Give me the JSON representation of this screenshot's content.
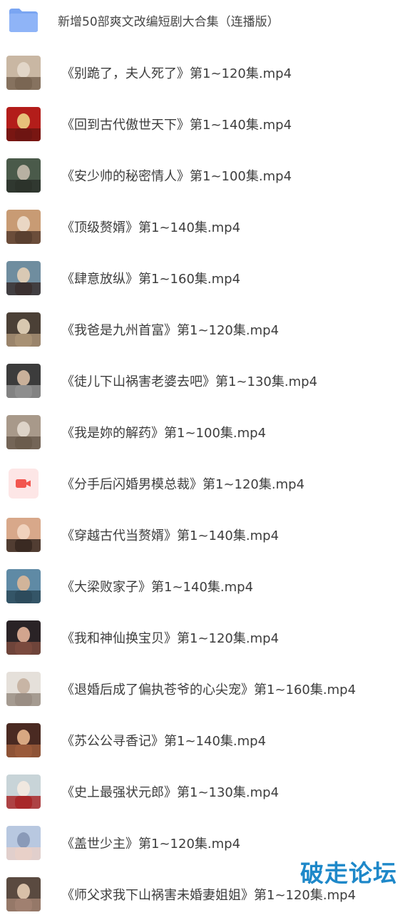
{
  "colors": {
    "folder": "#8fb4f7",
    "folder_tab": "#7aa5f2",
    "video_icon": "#f2564f",
    "watermark": "#1e88c9"
  },
  "folder": {
    "name": "新增50部爽文改编短剧大合集（连播版）",
    "icon": "folder-icon"
  },
  "files": [
    {
      "name": "《别跪了，夫人死了》第1~120集.mp4",
      "thumb": "video-thumbnail",
      "palette": [
        "#c9b7a3",
        "#7a6653",
        "#e2d6c8"
      ]
    },
    {
      "name": "《回到古代傲世天下》第1~140集.mp4",
      "thumb": "video-thumbnail",
      "palette": [
        "#b31d1a",
        "#6e1512",
        "#e7c07a"
      ]
    },
    {
      "name": "《安少帅的秘密情人》第1~100集.mp4",
      "thumb": "video-thumbnail",
      "palette": [
        "#4a5a4a",
        "#2c332b",
        "#b8b1a2"
      ]
    },
    {
      "name": "《顶级赘婿》第1~140集.mp4",
      "thumb": "video-thumbnail",
      "palette": [
        "#c89b74",
        "#5a4030",
        "#ead7c4"
      ]
    },
    {
      "name": "《肆意放纵》第1~160集.mp4",
      "thumb": "video-thumbnail",
      "palette": [
        "#6f8d9f",
        "#3a3030",
        "#d9c9b4"
      ]
    },
    {
      "name": "《我爸是九州首富》第1~120集.mp4",
      "thumb": "video-thumbnail",
      "palette": [
        "#4b4036",
        "#a89174",
        "#d8c8b0"
      ]
    },
    {
      "name": "《徒儿下山祸害老婆去吧》第1~130集.mp4",
      "thumb": "video-thumbnail",
      "palette": [
        "#3c3c3c",
        "#8e8e8e",
        "#c9b09a"
      ]
    },
    {
      "name": "《我是妳的解药》第1~100集.mp4",
      "thumb": "video-thumbnail",
      "palette": [
        "#a8998a",
        "#6b5c4d",
        "#ddd3c8"
      ]
    },
    {
      "name": "《分手后闪婚男模总裁》第1~120集.mp4",
      "thumb": "video-icon",
      "palette": []
    },
    {
      "name": "《穿越古代当赘婿》第1~140集.mp4",
      "thumb": "video-thumbnail",
      "palette": [
        "#d8a88a",
        "#3a2a22",
        "#f0d2bd"
      ]
    },
    {
      "name": "《大梁败家子》第1~140集.mp4",
      "thumb": "video-thumbnail",
      "palette": [
        "#5f8aa5",
        "#2d4b5c",
        "#d1b49a"
      ]
    },
    {
      "name": "《我和神仙换宝贝》第1~120集.mp4",
      "thumb": "video-thumbnail",
      "palette": [
        "#2a2326",
        "#7a4a3e",
        "#d2a58e"
      ]
    },
    {
      "name": "《退婚后成了偏执苍爷的心尖宠》第1~160集.mp4",
      "thumb": "video-thumbnail",
      "palette": [
        "#e5e0da",
        "#9a8e84",
        "#c8b5a5"
      ]
    },
    {
      "name": "《苏公公寻香记》第1~140集.mp4",
      "thumb": "video-thumbnail",
      "palette": [
        "#4a2a22",
        "#9a5a3a",
        "#d8a882"
      ]
    },
    {
      "name": "《史上最强状元郎》第1~130集.mp4",
      "thumb": "video-thumbnail",
      "palette": [
        "#c8d4d8",
        "#a8282a",
        "#f0e8e0"
      ]
    },
    {
      "name": "《盖世少主》第1~120集.mp4",
      "thumb": "video-thumbnail",
      "palette": [
        "#b8c8e0",
        "#e8d0c8",
        "#8a9ab8"
      ]
    },
    {
      "name": "《师父求我下山祸害未婚妻姐姐》第1~120集.mp4",
      "thumb": "video-thumbnail",
      "palette": [
        "#5a4a40",
        "#a08070",
        "#d8c0a8"
      ]
    }
  ],
  "watermark": "破走论坛"
}
